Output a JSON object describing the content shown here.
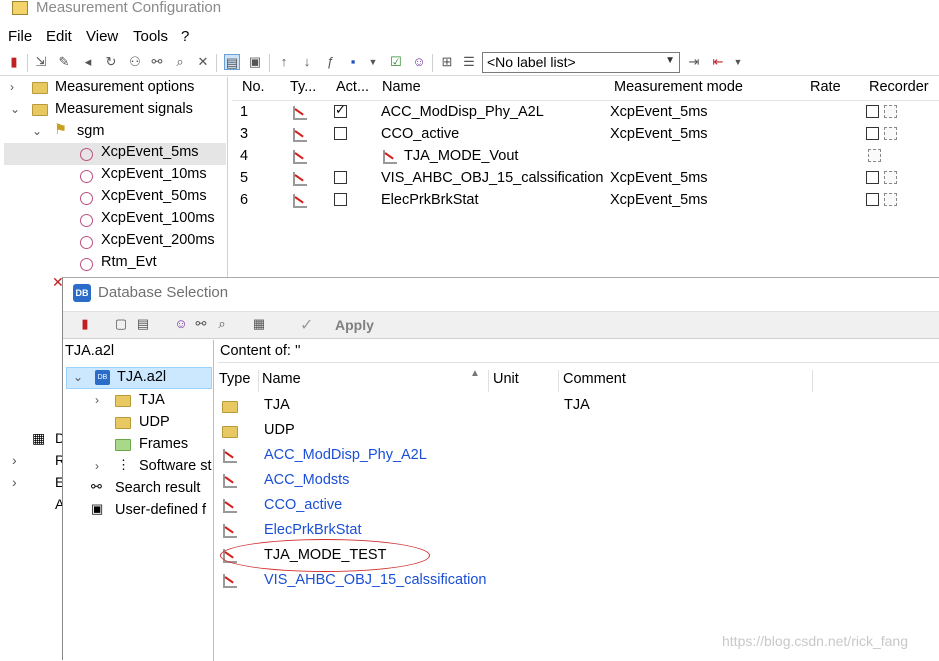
{
  "window": {
    "title": "Measurement Configuration"
  },
  "menu": [
    "File",
    "Edit",
    "View",
    "Tools",
    "?"
  ],
  "toolbar": {
    "label_list": "<No label list>"
  },
  "tree": {
    "measurement_options": "Measurement options",
    "measurement_signals": "Measurement signals",
    "group": "sgm",
    "events": [
      "XcpEvent_5ms",
      "XcpEvent_10ms",
      "XcpEvent_50ms",
      "XcpEvent_100ms",
      "XcpEvent_200ms",
      "Rtm_Evt"
    ],
    "selected_event": "XcpEvent_5ms"
  },
  "signal_table": {
    "headers": [
      "No.",
      "Ty...",
      "Act...",
      "Name",
      "Measurement mode",
      "Rate",
      "Recorder"
    ],
    "rows": [
      {
        "no": "1",
        "active": true,
        "name": "ACC_ModDisp_Phy_A2L",
        "mode": "XcpEvent_5ms"
      },
      {
        "no": "3",
        "active": false,
        "name": "CCO_active",
        "mode": "XcpEvent_5ms"
      },
      {
        "no": "4",
        "active": null,
        "name": "TJA_MODE_Vout",
        "mode": ""
      },
      {
        "no": "5",
        "active": false,
        "name": "VIS_AHBC_OBJ_15_calssification",
        "mode": "XcpEvent_5ms"
      },
      {
        "no": "6",
        "active": false,
        "name": "ElecPrkBrkStat",
        "mode": "XcpEvent_5ms"
      }
    ]
  },
  "dialog": {
    "title": "Database Selection",
    "apply": "Apply",
    "left_header": "TJA.a2l",
    "tree_root": "TJA.a2l",
    "tree_items": [
      "TJA",
      "UDP",
      "Frames",
      "Software st",
      "Search result",
      "User-defined f"
    ],
    "content_header": "Content of: ''",
    "columns": [
      "Type",
      "Name",
      "Unit",
      "Comment"
    ],
    "items": [
      {
        "name": "TJA",
        "comment": "TJA",
        "kind": "folder"
      },
      {
        "name": "UDP",
        "comment": "",
        "kind": "folder"
      },
      {
        "name": "ACC_ModDisp_Phy_A2L",
        "comment": "",
        "kind": "signal-link"
      },
      {
        "name": "ACC_Modsts",
        "comment": "",
        "kind": "signal-link"
      },
      {
        "name": "CCO_active",
        "comment": "",
        "kind": "signal-link"
      },
      {
        "name": "ElecPrkBrkStat",
        "comment": "",
        "kind": "signal-link"
      },
      {
        "name": "TJA_MODE_TEST",
        "comment": "",
        "kind": "signal"
      },
      {
        "name": "VIS_AHBC_OBJ_15_calssification",
        "comment": "",
        "kind": "signal-link"
      }
    ]
  },
  "left_stub_letters": [
    "D",
    "R",
    "E",
    "A"
  ],
  "watermark": "https://blog.csdn.net/rick_fang",
  "colors": {
    "link": "#1a4fd6",
    "annotation": "#d03030"
  }
}
